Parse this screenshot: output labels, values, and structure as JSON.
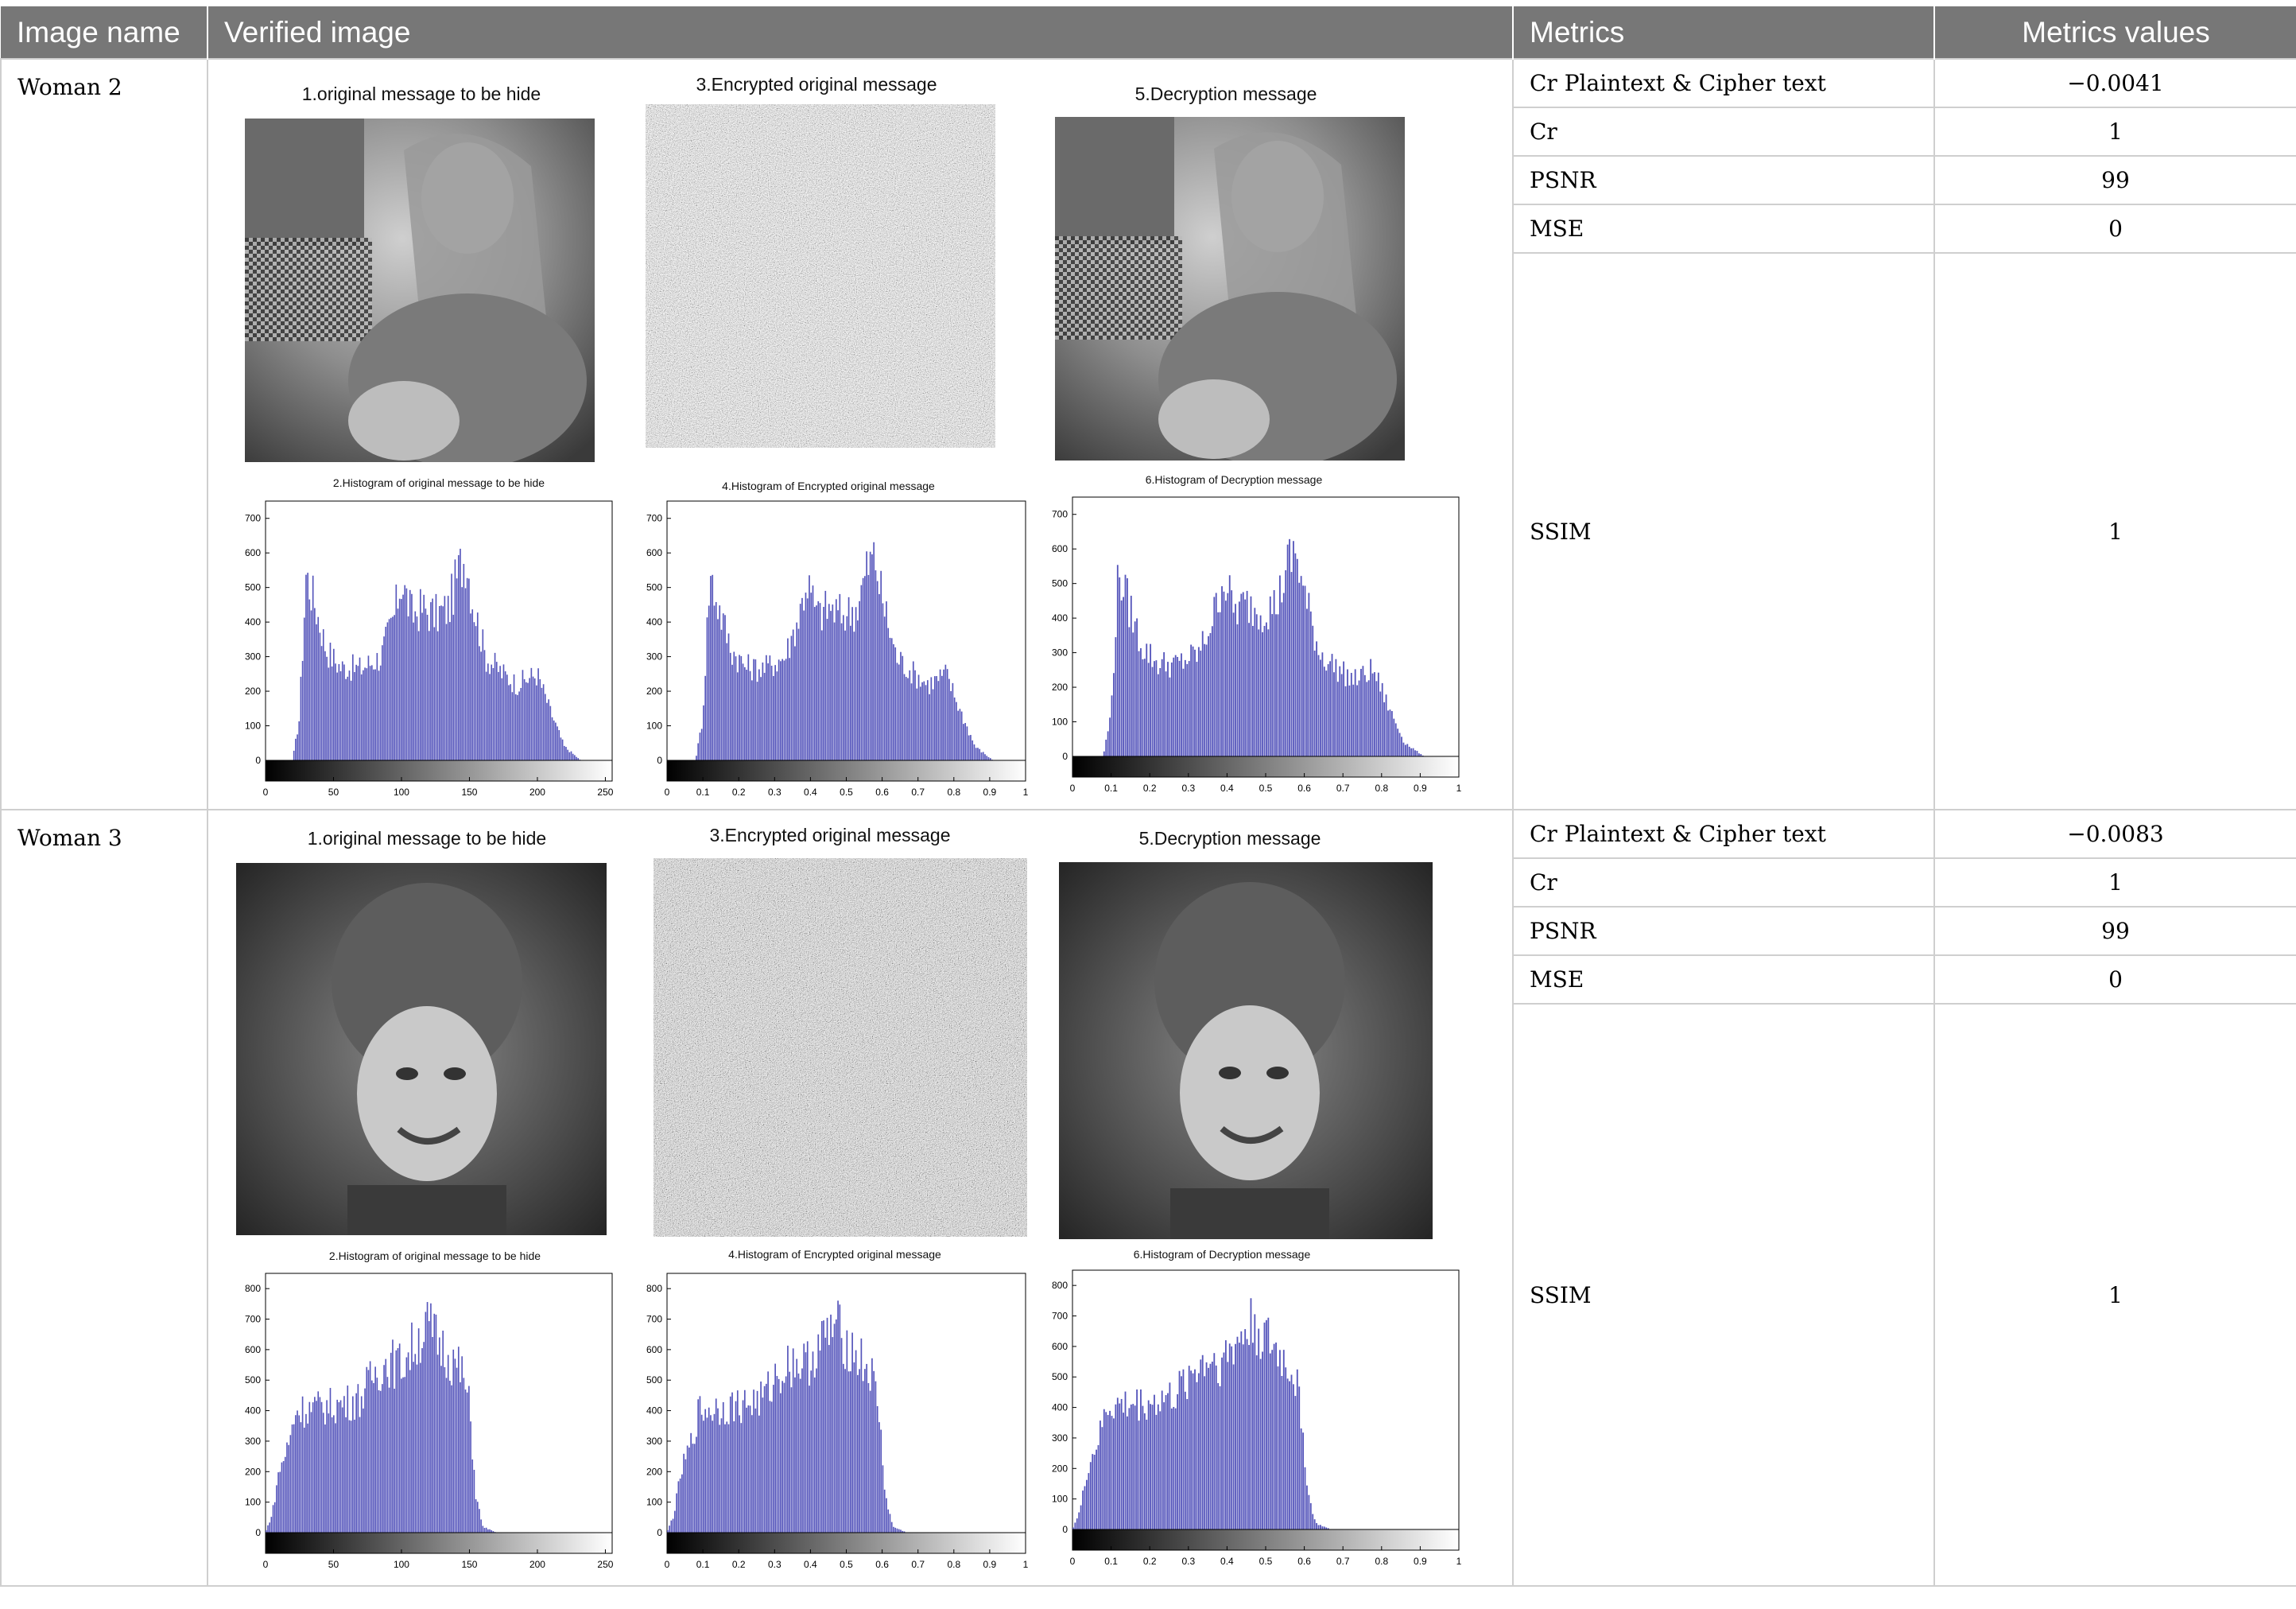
{
  "table": {
    "headers": {
      "image_name": "Image name",
      "verified_image": "Verified image",
      "metrics": "Metrics",
      "metrics_values": "Metrics values"
    },
    "rows": [
      {
        "name": "Woman 2",
        "captions": {
          "original": "1.original message to be hide",
          "encrypted": "3.Encrypted original message",
          "decrypted": "5.Decryption message",
          "hist_original": "2.Histogram of original message to be hide",
          "hist_encrypted": "4.Histogram of Encrypted original message",
          "hist_decrypted": "6.Histogram of Decryption message"
        },
        "metrics": [
          {
            "label": "Cr Plaintext & Cipher text",
            "value": "−0.0041"
          },
          {
            "label": "Cr",
            "value": "1"
          },
          {
            "label": "PSNR",
            "value": "99"
          },
          {
            "label": "MSE",
            "value": "0"
          },
          {
            "label": "SSIM",
            "value": "1"
          }
        ]
      },
      {
        "name": "Woman 3",
        "captions": {
          "original": "1.original message to be hide",
          "encrypted": "3.Encrypted original message",
          "decrypted": "5.Decryption message",
          "hist_original": "2.Histogram of original message to be hide",
          "hist_encrypted": "4.Histogram of Encrypted original message",
          "hist_decrypted": "6.Histogram of Decryption message"
        },
        "metrics": [
          {
            "label": "Cr Plaintext & Cipher text",
            "value": "−0.0083"
          },
          {
            "label": "Cr",
            "value": "1"
          },
          {
            "label": "PSNR",
            "value": "99"
          },
          {
            "label": "MSE",
            "value": "0"
          },
          {
            "label": "SSIM",
            "value": "1"
          }
        ]
      }
    ]
  },
  "chart_data": [
    {
      "type": "bar",
      "title": "2.Histogram of original message to be hide",
      "xlim": [
        0,
        255
      ],
      "ylim": [
        0,
        750
      ],
      "xticks": [
        "0",
        "50",
        "100",
        "150",
        "200",
        "250"
      ],
      "yticks": [
        "0",
        "100",
        "200",
        "300",
        "400",
        "500",
        "600",
        "700"
      ],
      "profile": [
        [
          0,
          0
        ],
        [
          20,
          0
        ],
        [
          25,
          120
        ],
        [
          30,
          540
        ],
        [
          36,
          460
        ],
        [
          45,
          320
        ],
        [
          55,
          270
        ],
        [
          70,
          265
        ],
        [
          85,
          300
        ],
        [
          95,
          420
        ],
        [
          100,
          520
        ],
        [
          108,
          420
        ],
        [
          115,
          440
        ],
        [
          125,
          420
        ],
        [
          135,
          440
        ],
        [
          143,
          560
        ],
        [
          148,
          590
        ],
        [
          152,
          470
        ],
        [
          162,
          300
        ],
        [
          175,
          250
        ],
        [
          185,
          220
        ],
        [
          200,
          250
        ],
        [
          210,
          140
        ],
        [
          220,
          40
        ],
        [
          232,
          0
        ],
        [
          255,
          0
        ]
      ]
    },
    {
      "type": "bar",
      "title": "4.Histogram of Encrypted original message",
      "xlim": [
        0,
        1
      ],
      "ylim": [
        0,
        750
      ],
      "xticks": [
        "0",
        "0.1",
        "0.2",
        "0.3",
        "0.4",
        "0.5",
        "0.6",
        "0.7",
        "0.8",
        "0.9",
        "1"
      ],
      "yticks": [
        "0",
        "100",
        "200",
        "300",
        "400",
        "500",
        "600",
        "700"
      ],
      "profile": [
        [
          0,
          0
        ],
        [
          0.08,
          0
        ],
        [
          0.1,
          120
        ],
        [
          0.12,
          540
        ],
        [
          0.14,
          460
        ],
        [
          0.18,
          320
        ],
        [
          0.22,
          270
        ],
        [
          0.27,
          265
        ],
        [
          0.33,
          300
        ],
        [
          0.37,
          420
        ],
        [
          0.39,
          520
        ],
        [
          0.42,
          420
        ],
        [
          0.45,
          440
        ],
        [
          0.49,
          420
        ],
        [
          0.53,
          440
        ],
        [
          0.56,
          560
        ],
        [
          0.58,
          590
        ],
        [
          0.6,
          470
        ],
        [
          0.64,
          300
        ],
        [
          0.69,
          250
        ],
        [
          0.73,
          220
        ],
        [
          0.78,
          250
        ],
        [
          0.82,
          140
        ],
        [
          0.86,
          40
        ],
        [
          0.91,
          0
        ],
        [
          1,
          0
        ]
      ]
    },
    {
      "type": "bar",
      "title": "6.Histogram of Decryption message",
      "xlim": [
        0,
        1
      ],
      "ylim": [
        0,
        750
      ],
      "xticks": [
        "0",
        "0.1",
        "0.2",
        "0.3",
        "0.4",
        "0.5",
        "0.6",
        "0.7",
        "0.8",
        "0.9",
        "1"
      ],
      "yticks": [
        "0",
        "100",
        "200",
        "300",
        "400",
        "500",
        "600",
        "700"
      ],
      "profile": [
        [
          0,
          0
        ],
        [
          0.08,
          0
        ],
        [
          0.1,
          120
        ],
        [
          0.12,
          540
        ],
        [
          0.14,
          460
        ],
        [
          0.18,
          320
        ],
        [
          0.22,
          270
        ],
        [
          0.27,
          265
        ],
        [
          0.33,
          300
        ],
        [
          0.37,
          420
        ],
        [
          0.39,
          520
        ],
        [
          0.42,
          420
        ],
        [
          0.45,
          440
        ],
        [
          0.49,
          420
        ],
        [
          0.53,
          440
        ],
        [
          0.56,
          560
        ],
        [
          0.58,
          590
        ],
        [
          0.6,
          470
        ],
        [
          0.64,
          300
        ],
        [
          0.69,
          250
        ],
        [
          0.73,
          220
        ],
        [
          0.78,
          250
        ],
        [
          0.82,
          140
        ],
        [
          0.86,
          40
        ],
        [
          0.91,
          0
        ],
        [
          1,
          0
        ]
      ]
    },
    {
      "type": "bar",
      "title": "2.Histogram of original message to be hide",
      "xlim": [
        0,
        255
      ],
      "ylim": [
        0,
        850
      ],
      "xticks": [
        "0",
        "50",
        "100",
        "150",
        "200",
        "250"
      ],
      "yticks": [
        "0",
        "100",
        "200",
        "300",
        "400",
        "500",
        "600",
        "700",
        "800"
      ],
      "profile": [
        [
          0,
          0
        ],
        [
          5,
          60
        ],
        [
          10,
          200
        ],
        [
          18,
          300
        ],
        [
          22,
          400
        ],
        [
          40,
          410
        ],
        [
          55,
          420
        ],
        [
          70,
          440
        ],
        [
          80,
          520
        ],
        [
          90,
          560
        ],
        [
          100,
          550
        ],
        [
          110,
          620
        ],
        [
          120,
          680
        ],
        [
          125,
          640
        ],
        [
          135,
          580
        ],
        [
          145,
          520
        ],
        [
          150,
          420
        ],
        [
          155,
          120
        ],
        [
          160,
          20
        ],
        [
          170,
          0
        ],
        [
          255,
          0
        ]
      ]
    },
    {
      "type": "bar",
      "title": "4.Histogram of Encrypted original message",
      "xlim": [
        0,
        1
      ],
      "ylim": [
        0,
        850
      ],
      "xticks": [
        "0",
        "0.1",
        "0.2",
        "0.3",
        "0.4",
        "0.5",
        "0.6",
        "0.7",
        "0.8",
        "0.9",
        "1"
      ],
      "yticks": [
        "0",
        "100",
        "200",
        "300",
        "400",
        "500",
        "600",
        "700",
        "800"
      ],
      "profile": [
        [
          0,
          0
        ],
        [
          0.02,
          60
        ],
        [
          0.04,
          200
        ],
        [
          0.07,
          300
        ],
        [
          0.09,
          400
        ],
        [
          0.16,
          410
        ],
        [
          0.22,
          420
        ],
        [
          0.27,
          440
        ],
        [
          0.31,
          520
        ],
        [
          0.35,
          560
        ],
        [
          0.39,
          550
        ],
        [
          0.43,
          620
        ],
        [
          0.47,
          680
        ],
        [
          0.49,
          640
        ],
        [
          0.53,
          580
        ],
        [
          0.57,
          520
        ],
        [
          0.59,
          420
        ],
        [
          0.61,
          120
        ],
        [
          0.63,
          20
        ],
        [
          0.67,
          0
        ],
        [
          1,
          0
        ]
      ]
    },
    {
      "type": "bar",
      "title": "6.Histogram of Decryption message",
      "xlim": [
        0,
        1
      ],
      "ylim": [
        0,
        850
      ],
      "xticks": [
        "0",
        "0.1",
        "0.2",
        "0.3",
        "0.4",
        "0.5",
        "0.6",
        "0.7",
        "0.8",
        "0.9",
        "1"
      ],
      "yticks": [
        "0",
        "100",
        "200",
        "300",
        "400",
        "500",
        "600",
        "700",
        "800"
      ],
      "profile": [
        [
          0,
          0
        ],
        [
          0.02,
          60
        ],
        [
          0.04,
          200
        ],
        [
          0.07,
          300
        ],
        [
          0.09,
          400
        ],
        [
          0.16,
          410
        ],
        [
          0.22,
          420
        ],
        [
          0.27,
          440
        ],
        [
          0.31,
          520
        ],
        [
          0.35,
          560
        ],
        [
          0.39,
          550
        ],
        [
          0.43,
          620
        ],
        [
          0.47,
          680
        ],
        [
          0.49,
          640
        ],
        [
          0.53,
          580
        ],
        [
          0.57,
          520
        ],
        [
          0.59,
          420
        ],
        [
          0.61,
          120
        ],
        [
          0.63,
          20
        ],
        [
          0.67,
          0
        ],
        [
          1,
          0
        ]
      ]
    }
  ]
}
